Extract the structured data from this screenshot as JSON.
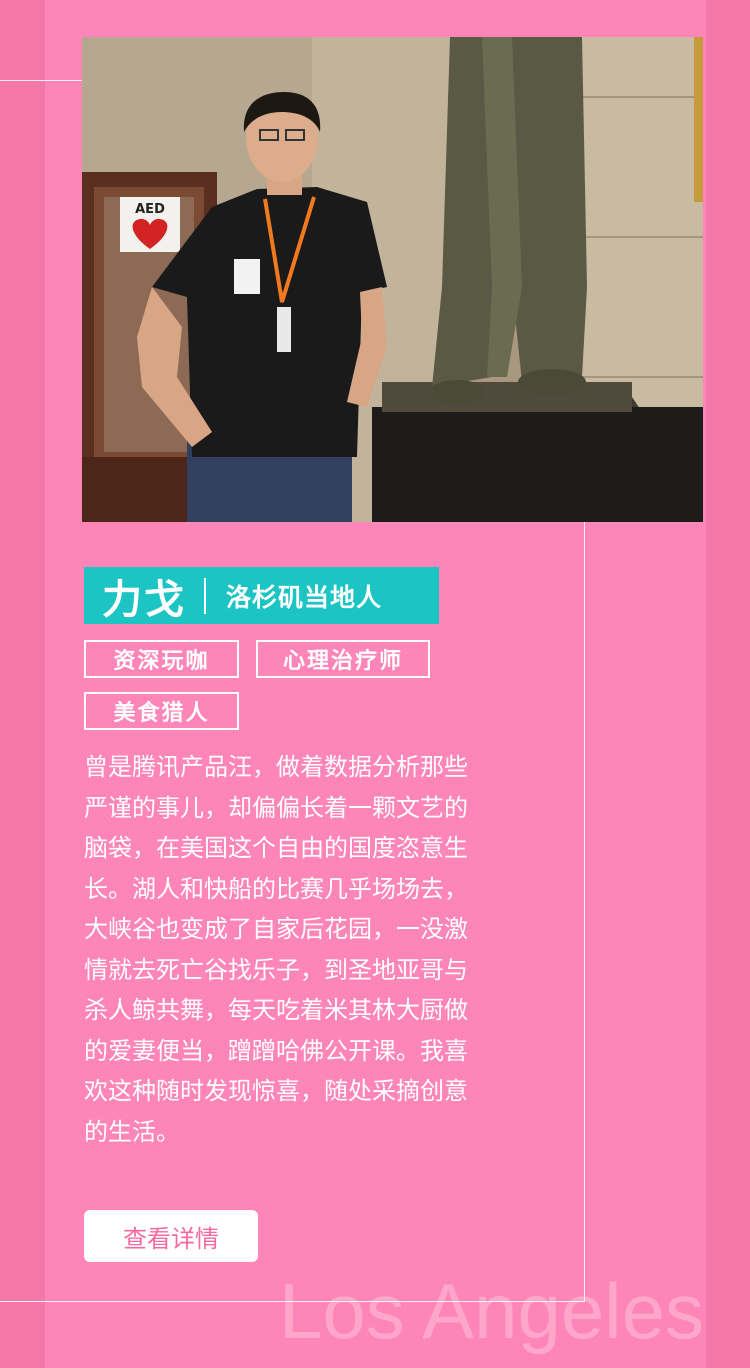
{
  "colors": {
    "background": "#f377a9",
    "panel": "#fe85b8",
    "accent": "#1dc4c4",
    "button_text": "#f7699f"
  },
  "profile": {
    "name": "力戈",
    "location": "洛杉矶当地人",
    "tags": [
      "资深玩咖",
      "心理治疗师",
      "美食猎人"
    ]
  },
  "bio_lines": [
    "曾是腾讯产品汪，做着数据分析那些",
    "严谨的事儿，却偏偏长着一颗文艺的",
    "脑袋，在美国这个自由的国度恣意生",
    "长。湖人和快船的比赛几乎场场去，",
    "大峡谷也变成了自家后花园，一没激",
    "情就去死亡谷找乐子，到圣地亚哥与",
    "杀人鲸共舞，每天吃着米其林大厨做",
    "的爱妻便当，蹭蹭哈佛公开课。我喜",
    "欢这种随时发现惊喜，随处采摘创意",
    "的生活。"
  ],
  "photo": {
    "sign_text": "AED"
  },
  "button": {
    "label": "查看详情"
  },
  "watermark": "Los Angeles"
}
